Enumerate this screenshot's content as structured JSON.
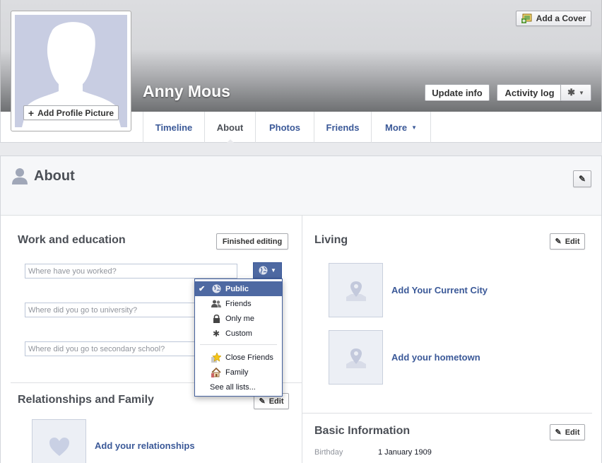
{
  "profile": {
    "name": "Anny Mous",
    "add_profile_picture": "Add Profile Picture"
  },
  "header_buttons": {
    "add_cover": "Add a Cover",
    "update_info": "Update info",
    "activity_log": "Activity log"
  },
  "tabs": [
    {
      "label": "Timeline"
    },
    {
      "label": "About"
    },
    {
      "label": "Photos"
    },
    {
      "label": "Friends"
    },
    {
      "label": "More"
    }
  ],
  "about": {
    "title": "About"
  },
  "work_education": {
    "title": "Work and education",
    "finished_editing": "Finished editing",
    "worked_placeholder": "Where have you worked?",
    "university_placeholder": "Where did you go to university?",
    "secondary_placeholder": "Where did you go to secondary school?"
  },
  "privacy_menu": {
    "items": [
      {
        "label": "Public",
        "icon": "globe-icon"
      },
      {
        "label": "Friends",
        "icon": "friends-icon"
      },
      {
        "label": "Only me",
        "icon": "lock-icon"
      },
      {
        "label": "Custom",
        "icon": "gear-icon"
      },
      {
        "label": "Close Friends",
        "icon": "star-icon"
      },
      {
        "label": "Family",
        "icon": "house-icon"
      }
    ],
    "see_all": "See all lists..."
  },
  "relationships": {
    "title": "Relationships and Family",
    "edit": "Edit",
    "add_link": "Add your relationships"
  },
  "living": {
    "title": "Living",
    "edit": "Edit",
    "current_city": "Add Your Current City",
    "hometown": "Add your hometown"
  },
  "basic_info": {
    "title": "Basic Information",
    "edit": "Edit",
    "birthday_label": "Birthday",
    "birthday_value": "1 January 1909"
  },
  "colors": {
    "link": "#3b5998",
    "menu_selected": "#4e69a2",
    "placeholder_bg": "#c8cde2"
  }
}
